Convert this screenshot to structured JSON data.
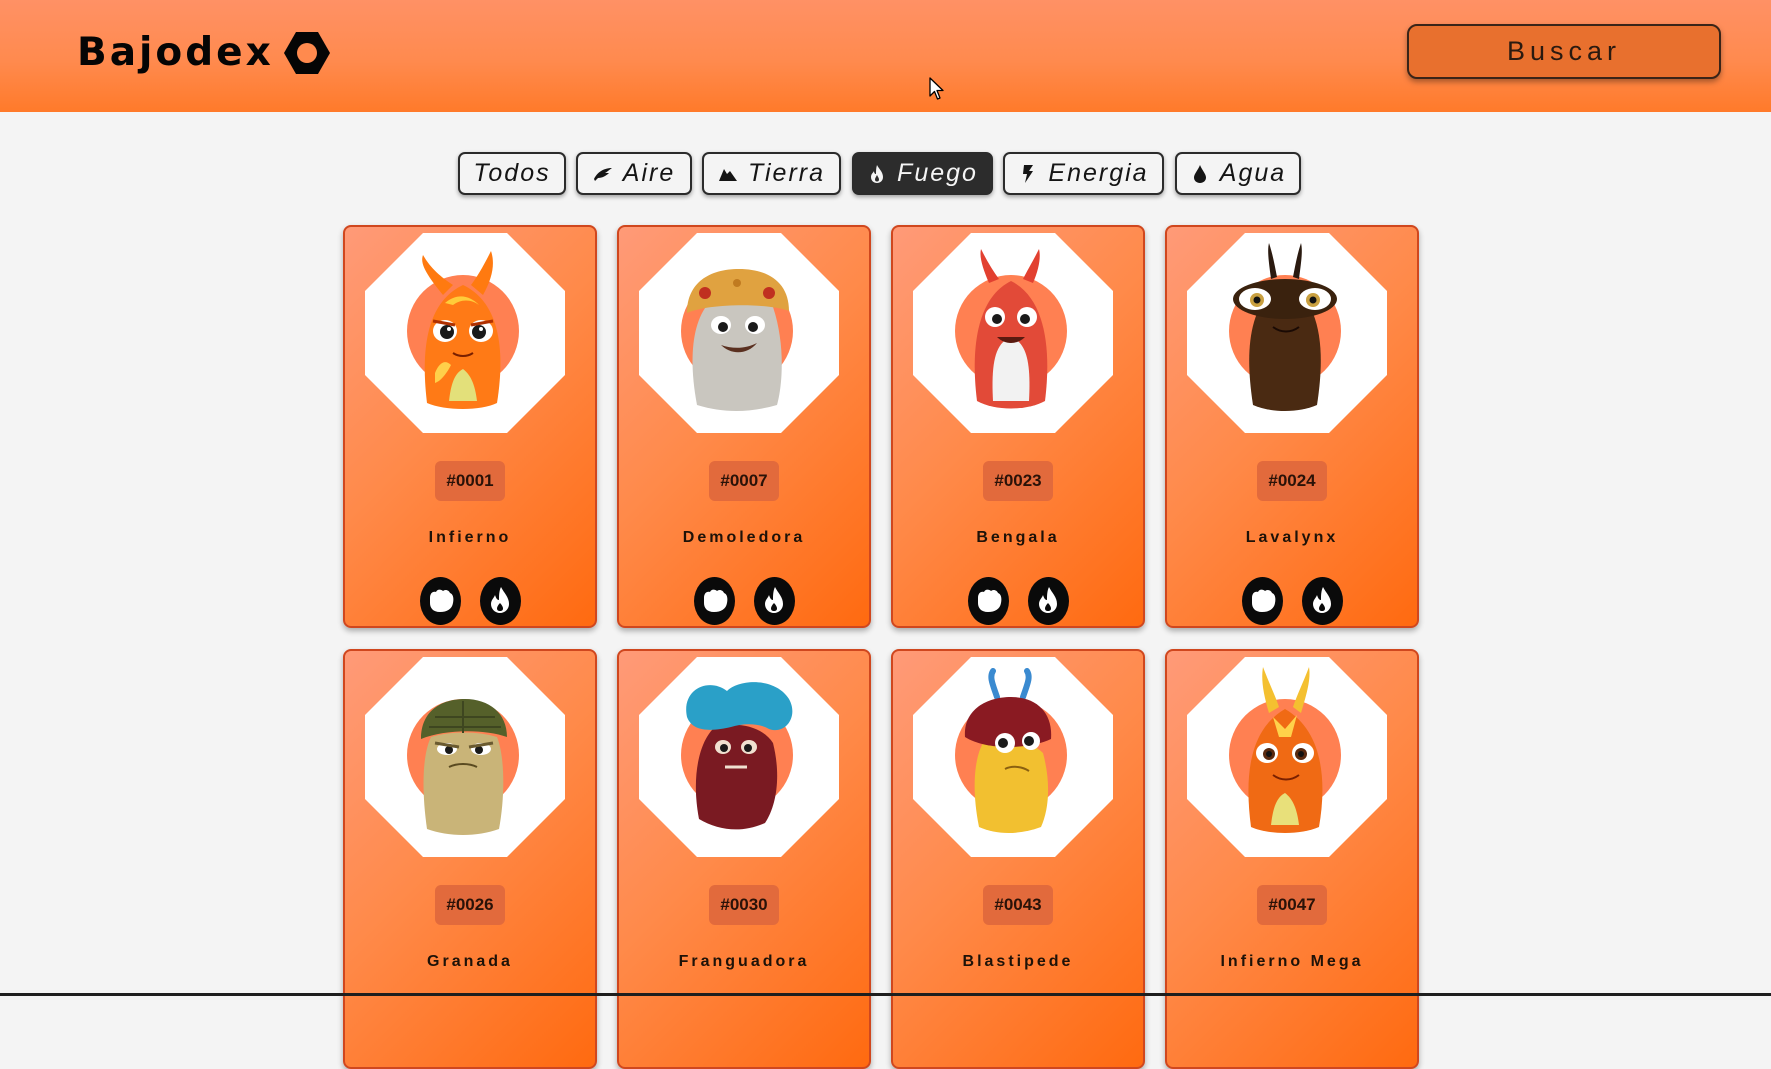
{
  "header": {
    "logo_text": "Bajodex",
    "search_label": "Buscar"
  },
  "colors": {
    "header": "#ff8a4e",
    "card": "#ff7a2a",
    "badge": "#e26a3c",
    "active_filter": "#2c2c2c"
  },
  "filters": [
    {
      "label": "Todos",
      "icon": "none",
      "active": false
    },
    {
      "label": "Aire",
      "icon": "wing-icon",
      "active": false
    },
    {
      "label": "Tierra",
      "icon": "mountain-icon",
      "active": false
    },
    {
      "label": "Fuego",
      "icon": "flame-icon",
      "active": true
    },
    {
      "label": "Energia",
      "icon": "lightning-icon",
      "active": false
    },
    {
      "label": "Agua",
      "icon": "water-drop-icon",
      "active": false
    }
  ],
  "slugs": [
    {
      "number": "#0001",
      "name": "Infierno",
      "elements": [
        "fist-icon",
        "flame-icon"
      ]
    },
    {
      "number": "#0007",
      "name": "Demoledora",
      "elements": [
        "fist-icon",
        "flame-icon"
      ]
    },
    {
      "number": "#0023",
      "name": "Bengala",
      "elements": [
        "fist-icon",
        "flame-icon"
      ]
    },
    {
      "number": "#0024",
      "name": "Lavalynx",
      "elements": [
        "fist-icon",
        "flame-icon"
      ]
    },
    {
      "number": "#0026",
      "name": "Granada",
      "elements": []
    },
    {
      "number": "#0030",
      "name": "Franguadora",
      "elements": []
    },
    {
      "number": "#0043",
      "name": "Blastipede",
      "elements": []
    },
    {
      "number": "#0047",
      "name": "Infierno Mega",
      "elements": []
    }
  ]
}
